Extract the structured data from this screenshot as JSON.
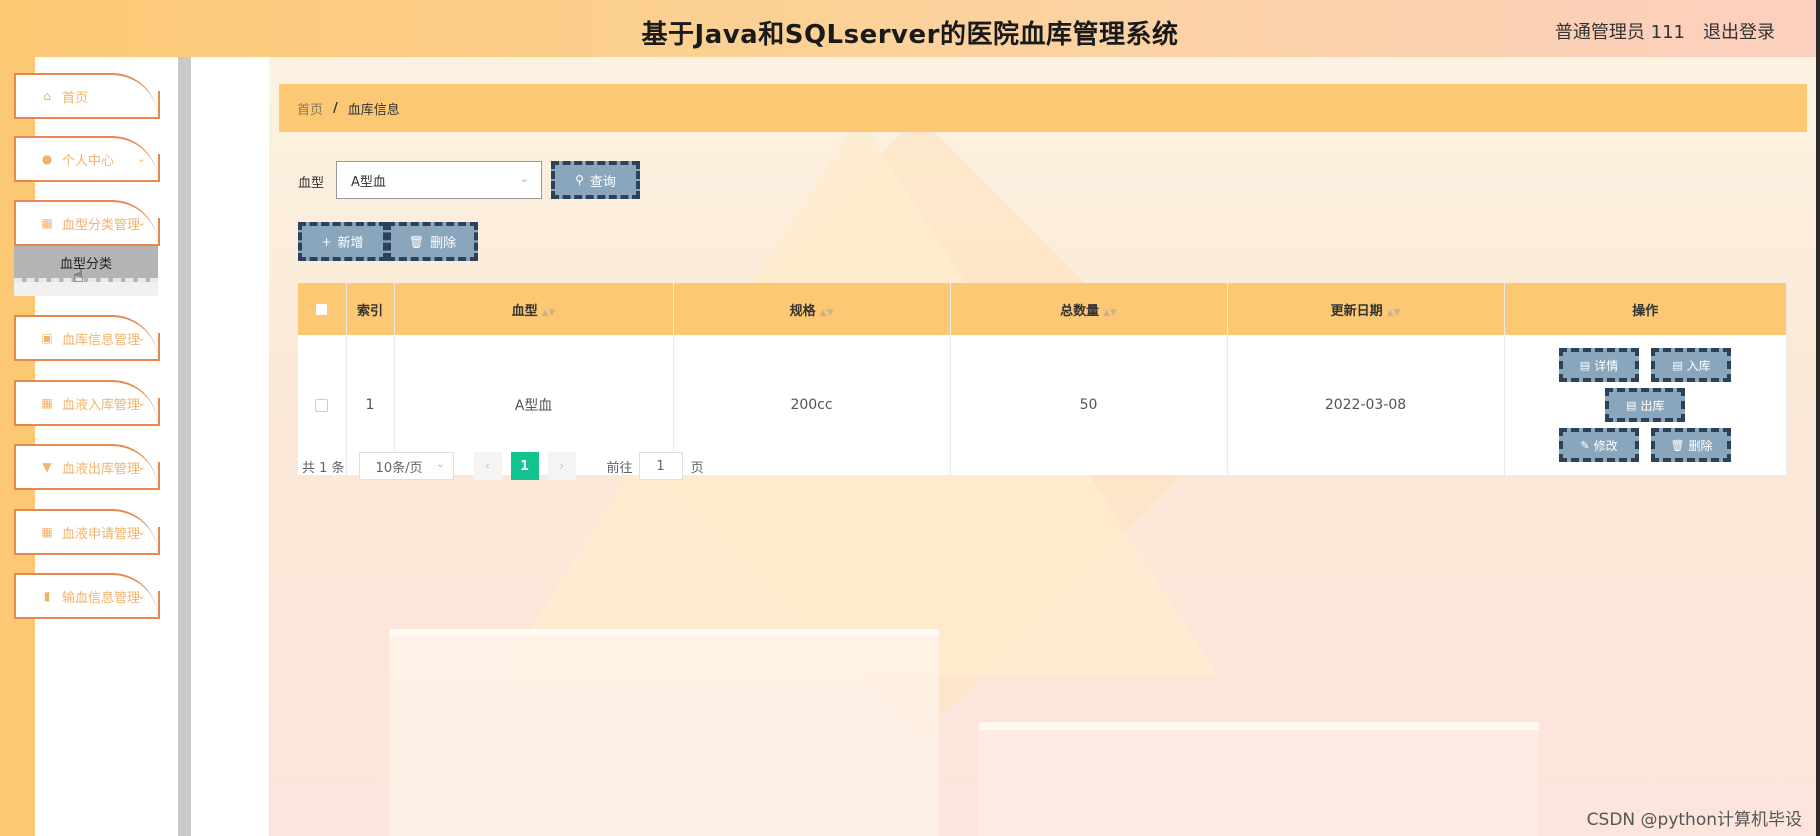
{
  "header": {
    "title": "基于Java和SQLserver的医院血库管理系统",
    "user": "普通管理员 111",
    "logout": "退出登录"
  },
  "sidebar": {
    "items": [
      {
        "label": "首页",
        "icon": "home-icon"
      },
      {
        "label": "个人中心",
        "icon": "user-icon"
      },
      {
        "label": "血型分类管理",
        "icon": "grid-icon"
      },
      {
        "label": "血库信息管理",
        "icon": "briefcase-icon"
      },
      {
        "label": "血液入库管理",
        "icon": "grid-icon"
      },
      {
        "label": "血液出库管理",
        "icon": "trophy-icon"
      },
      {
        "label": "血液申请管理",
        "icon": "grid-icon"
      },
      {
        "label": "输血信息管理",
        "icon": "clipboard-icon"
      }
    ],
    "submenu": {
      "label": "血型分类"
    }
  },
  "breadcrumb": {
    "home": "首页",
    "separator": "/",
    "current": "血库信息"
  },
  "filter": {
    "label": "血型",
    "value": "A型血",
    "search_button": "查询"
  },
  "toolbar": {
    "add": "新增",
    "delete": "删除"
  },
  "table": {
    "headers": {
      "index": "索引",
      "blood_type": "血型",
      "spec": "规格",
      "total": "总数量",
      "date": "更新日期",
      "ops": "操作"
    },
    "rows": [
      {
        "index": "1",
        "blood_type": "A型血",
        "spec": "200cc",
        "total": "50",
        "date": "2022-03-08"
      }
    ],
    "actions": {
      "detail": "详情",
      "in": "入库",
      "out": "出库",
      "edit": "修改",
      "delete": "删除"
    }
  },
  "pagination": {
    "total": "共 1 条",
    "page_size": "10条/页",
    "current_page": "1",
    "goto_label": "前往",
    "goto_value": "1",
    "goto_suffix": "页"
  },
  "watermark": "CSDN @python计算机毕设",
  "colors": {
    "accent": "#fcc873",
    "button": "#8aa6bd",
    "button_border": "#2b4258",
    "active_page": "#13c28e",
    "menu_border": "#e8874a"
  }
}
